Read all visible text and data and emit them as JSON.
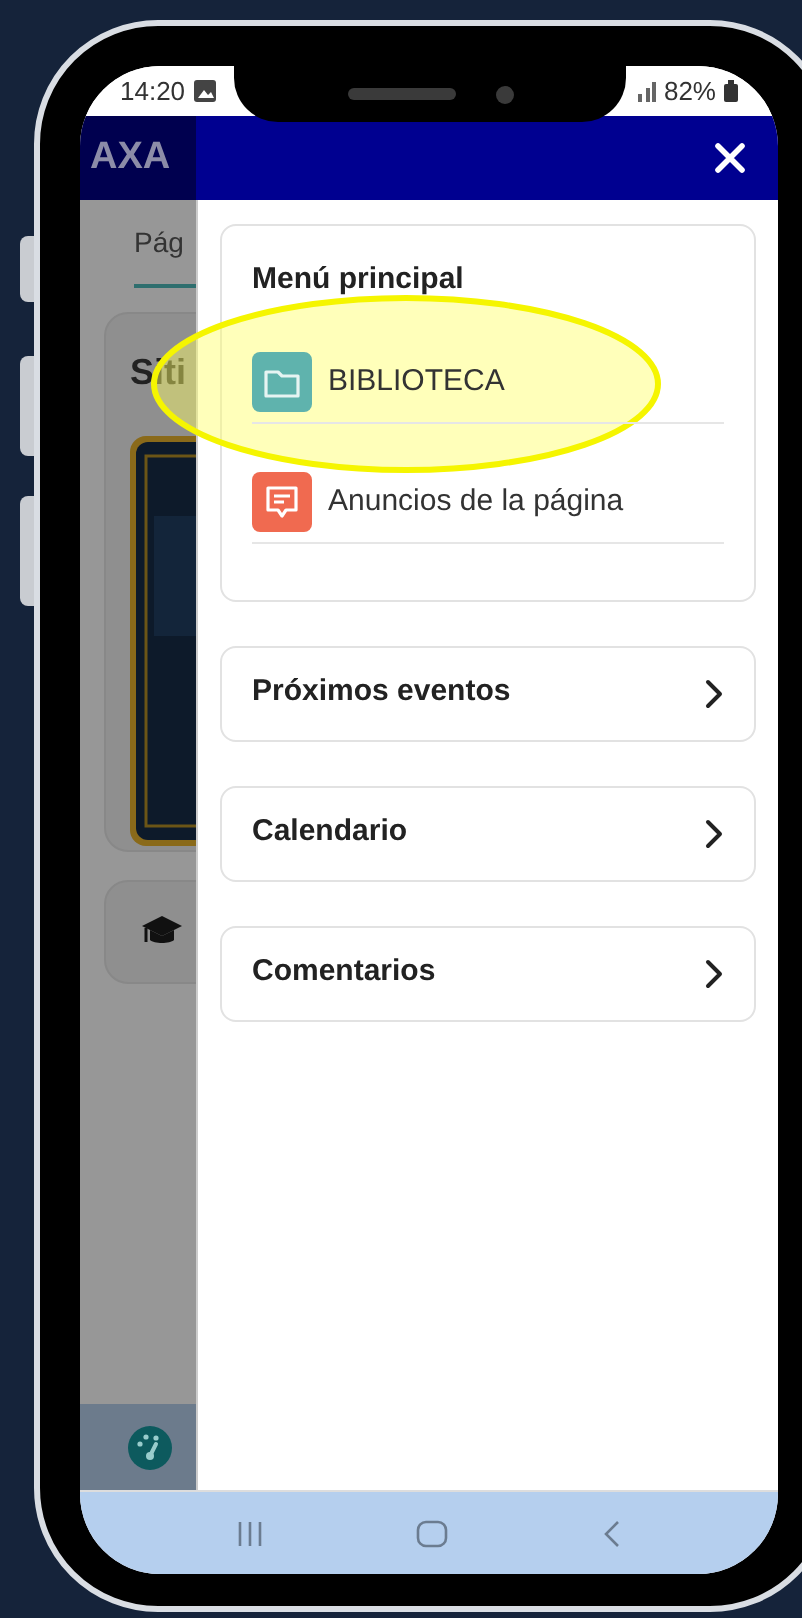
{
  "status_bar": {
    "time": "14:20",
    "battery": "82%"
  },
  "background_app": {
    "title": "AXA",
    "tab": "Pág",
    "card_title": "Siti"
  },
  "drawer": {
    "menu_title": "Menú principal",
    "menu_items": [
      {
        "label": "BIBLIOTECA",
        "kind": "folder",
        "highlighted": true
      },
      {
        "label": "Anuncios de la página",
        "kind": "announcement",
        "highlighted": false
      }
    ],
    "sections": [
      {
        "label": "Próximos eventos"
      },
      {
        "label": "Calendario"
      },
      {
        "label": "Comentarios"
      }
    ]
  }
}
